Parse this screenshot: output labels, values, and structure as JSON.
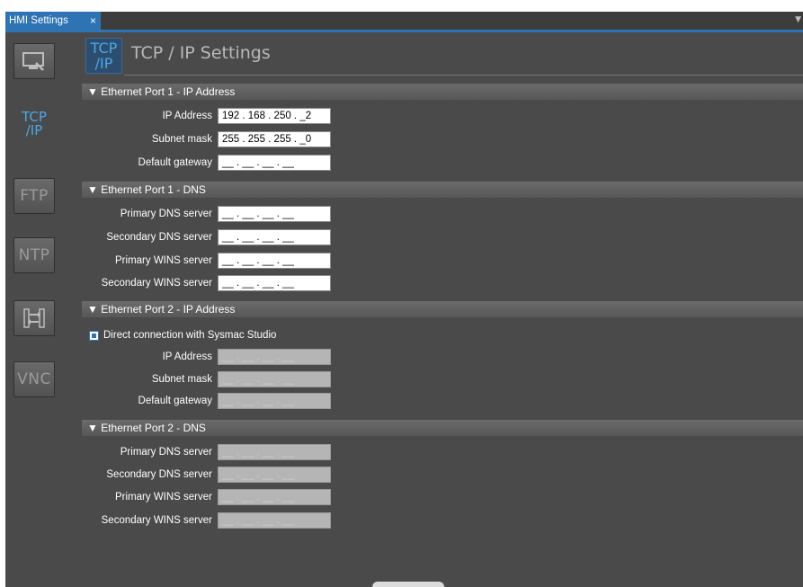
{
  "tab": {
    "title": "HMI Settings",
    "close": "×"
  },
  "page": {
    "title": "TCP / IP Settings"
  },
  "nav": {
    "tcpip_line1": "TCP",
    "tcpip_line2": "/IP",
    "ftp": "FTP",
    "ntp": "NTP",
    "vnc": "VNC"
  },
  "sections": [
    {
      "title": "▼ Ethernet Port 1 - IP Address",
      "fields": [
        {
          "label": "IP Address",
          "value": "192 . 168 . 250 . _2"
        },
        {
          "label": "Subnet mask",
          "value": "255 . 255 . 255 . _0"
        },
        {
          "label": "Default gateway",
          "value": "__ . __ . __ . __"
        }
      ]
    },
    {
      "title": "▼ Ethernet Port 1 - DNS",
      "fields": [
        {
          "label": "Primary DNS server",
          "value": "__ . __ . __ . __"
        },
        {
          "label": "Secondary DNS server",
          "value": "__ . __ . __ . __"
        },
        {
          "label": "Primary WINS server",
          "value": "__ . __ . __ . __"
        },
        {
          "label": "Secondary WINS server",
          "value": "__ . __ . __ . __"
        }
      ]
    },
    {
      "title": "▼ Ethernet Port 2 - IP Address",
      "checkbox": {
        "label": "Direct connection with Sysmac Studio",
        "checked": true
      },
      "fields": [
        {
          "label": "IP Address",
          "value": "__ . __ . __ . __"
        },
        {
          "label": "Subnet mask",
          "value": "__ . __ . __ . __"
        },
        {
          "label": "Default gateway",
          "value": "__ . __ . __ . __"
        }
      ]
    },
    {
      "title": "▼ Ethernet Port 2 - DNS",
      "fields": [
        {
          "label": "Primary DNS server",
          "value": "__ . __ . __ . __"
        },
        {
          "label": "Secondary DNS server",
          "value": "__ . __ . __ . __"
        },
        {
          "label": "Primary WINS server",
          "value": "__ . __ . __ . __"
        },
        {
          "label": "Secondary WINS server",
          "value": "__ . __ . __ . __"
        }
      ]
    }
  ],
  "colors": {
    "accent": "#2e74b5",
    "tcp_icon": "#4aa8e8",
    "background": "#4a4a4a"
  },
  "icons": {
    "hmi_device": "monitor-icon",
    "transfer": "transfer-arrows-icon"
  }
}
